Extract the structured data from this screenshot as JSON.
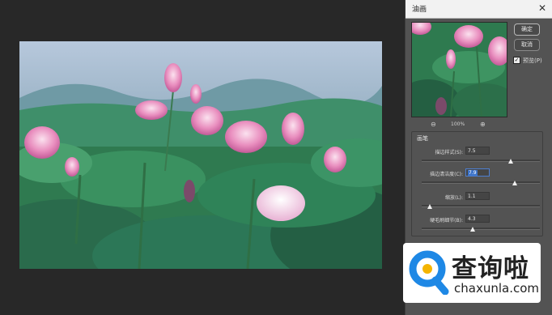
{
  "dialog": {
    "title": "油画",
    "close_glyph": "✕",
    "ok_label": "确定",
    "cancel_label": "取消",
    "preview_label": "预览(P)",
    "preview_checked": true,
    "zoom_out_glyph": "⊖",
    "zoom_in_glyph": "⊕",
    "zoom_level": "100%",
    "brush_group_label": "画笔",
    "params": [
      {
        "label": "描边样式(S):",
        "value": "7.5",
        "level": 0.75
      },
      {
        "label": "描边清洁度(C):",
        "value": "7.9",
        "level": 0.79,
        "selected": true
      },
      {
        "label": "缩放(L):",
        "value": "1.1",
        "level": 0.07
      },
      {
        "label": "硬毛刷细节(B):",
        "value": "4.3",
        "level": 0.43
      }
    ]
  },
  "icons": {
    "close": "close-icon",
    "zoom_out": "zoom-out-icon",
    "zoom_in": "zoom-in-icon",
    "checkbox": "checkmark-icon"
  },
  "watermark": {
    "text": "查询啦",
    "domain": "chaxunla.com",
    "brand_color": "#1e88e5"
  },
  "colors": {
    "workspace": "#282828",
    "dialog_bg": "#535353",
    "selection": "#3c73c9"
  }
}
